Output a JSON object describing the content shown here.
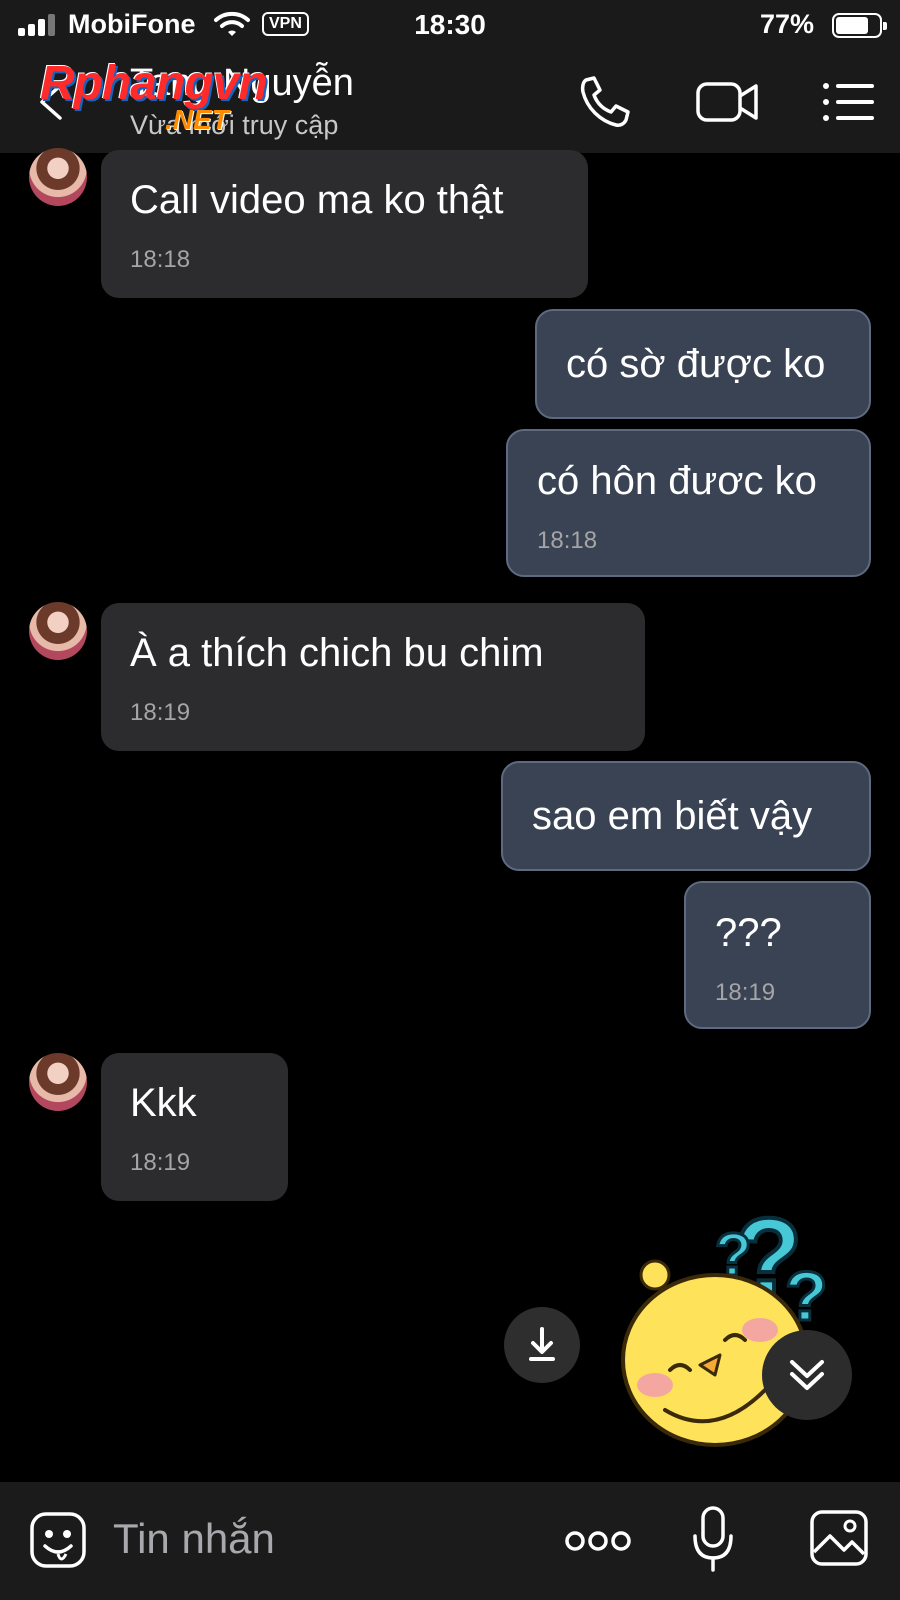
{
  "status_bar": {
    "carrier": "MobiFone",
    "vpn_label": "VPN",
    "time": "18:30",
    "battery_percent": "77%",
    "battery_level": 0.77
  },
  "watermark": {
    "brand": "Rphangvn",
    "suffix": ".NET"
  },
  "header": {
    "contact_name": "Tang Nguyễn",
    "contact_status": "Vừa mới truy cập"
  },
  "messages": [
    {
      "direction": "in",
      "text": "Call video ma ko thật",
      "time": "18:18"
    },
    {
      "direction": "out",
      "text": "có sờ được ko",
      "time": ""
    },
    {
      "direction": "out",
      "text": "có hôn đươc ko",
      "time": "18:18"
    },
    {
      "direction": "in",
      "text": "À  a thích chich  bu chim",
      "time": "18:19"
    },
    {
      "direction": "out",
      "text": "sao em biết vậy",
      "time": ""
    },
    {
      "direction": "out",
      "text": "???",
      "time": "18:19"
    },
    {
      "direction": "in",
      "text": "Kkk",
      "time": "18:19"
    }
  ],
  "input_bar": {
    "placeholder": "Tin nhắn"
  },
  "colors": {
    "incoming_bubble": "#2c2c2e",
    "outgoing_bubble": "#3a4354",
    "bar_background": "#1a1a1a"
  }
}
